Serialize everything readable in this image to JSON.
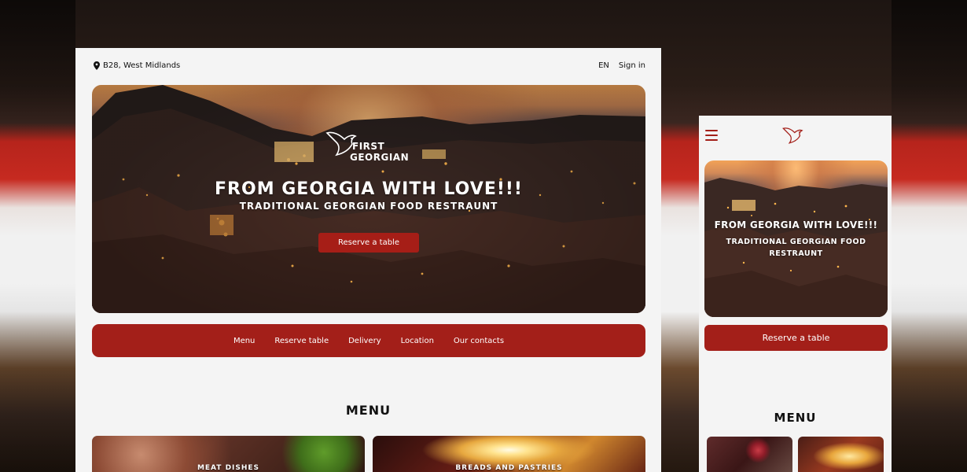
{
  "desktop": {
    "location": "B28, West Midlands",
    "lang": "EN",
    "signin": "Sign in",
    "logo": {
      "line1": "FIRST",
      "line2": "GEORGIAN"
    },
    "hero_title": "FROM GEORGIA WITH LOVE!!!",
    "hero_subtitle": "TRADITIONAL GEORGIAN FOOD RESTRAUNT",
    "hero_button": "Reserve a table",
    "nav": [
      "Menu",
      "Reserve table",
      "Delivery",
      "Location",
      "Our contacts"
    ],
    "menu_heading": "MENU",
    "cards": [
      "MEAT DISHES",
      "BREADS AND PASTRIES"
    ]
  },
  "mobile": {
    "hero_title": "FROM GEORGIA WITH LOVE!!!",
    "hero_subtitle": "TRADITIONAL GEORGIAN FOOD RESTRAUNT",
    "button": "Reserve a table",
    "menu_heading": "MENU"
  },
  "colors": {
    "brand_red": "#a31f19",
    "page_bg": "#f4f4f4"
  },
  "icons": [
    "location-pin-icon",
    "bird-logo-icon",
    "hamburger-menu-icon"
  ]
}
